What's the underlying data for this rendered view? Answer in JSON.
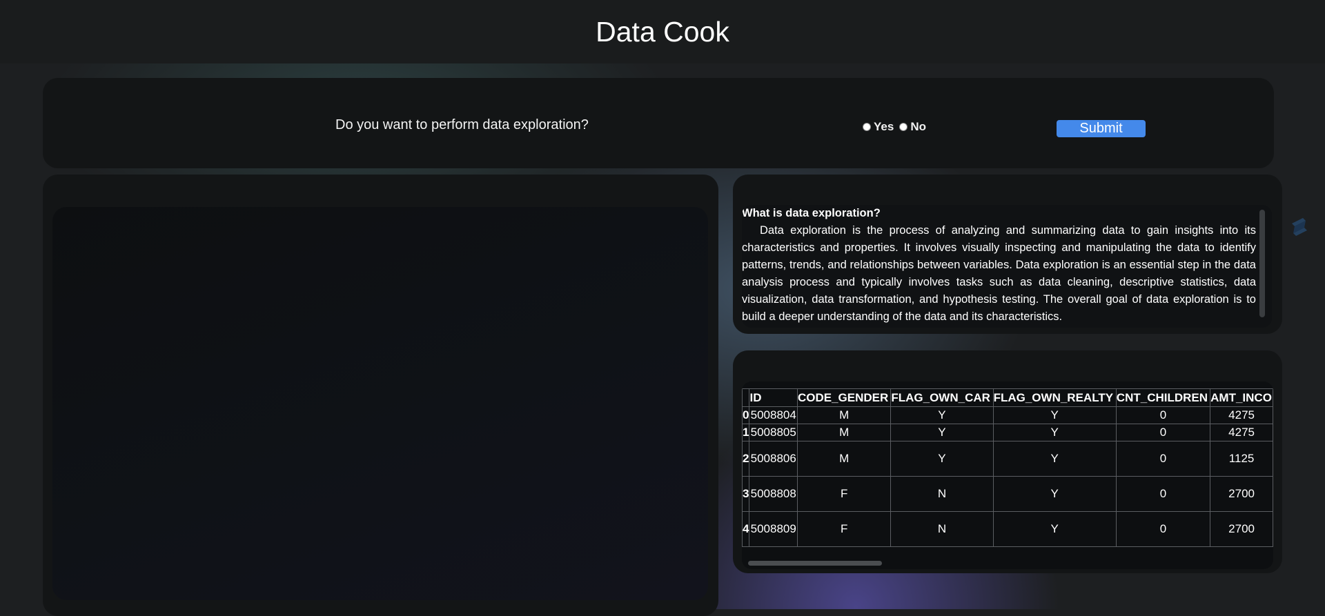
{
  "app": {
    "title": "Data Cook"
  },
  "question": {
    "text": "Do you want to perform data exploration?",
    "options": [
      "Yes",
      "No"
    ],
    "submit_label": "Submit"
  },
  "info": {
    "title": "What is data exploration?",
    "body": "Data exploration is the process of analyzing and summarizing data to gain insights into its characteristics and properties. It involves visually inspecting and manipulating the data to identify patterns, trends, and relationships between variables. Data exploration is an essential step in the data analysis process and typically involves tasks such as data cleaning, descriptive statistics, data visualization, data transformation, and hypothesis testing. The overall goal of data exploration is to build a deeper understanding of the data and its characteristics."
  },
  "table": {
    "columns": [
      "",
      "ID",
      "CODE_GENDER",
      "FLAG_OWN_CAR",
      "FLAG_OWN_REALTY",
      "CNT_CHILDREN",
      "AMT_INCO"
    ],
    "rows": [
      [
        "0",
        "5008804",
        "M",
        "Y",
        "Y",
        "0",
        "4275"
      ],
      [
        "1",
        "5008805",
        "M",
        "Y",
        "Y",
        "0",
        "4275"
      ],
      [
        "2",
        "5008806",
        "M",
        "Y",
        "Y",
        "0",
        "1125"
      ],
      [
        "3",
        "5008808",
        "F",
        "N",
        "Y",
        "0",
        "2700"
      ],
      [
        "4",
        "5008809",
        "F",
        "N",
        "Y",
        "0",
        "2700"
      ]
    ]
  },
  "icons": {
    "side": "streamlit-logo-icon"
  },
  "colors": {
    "accent": "#4489ea"
  }
}
